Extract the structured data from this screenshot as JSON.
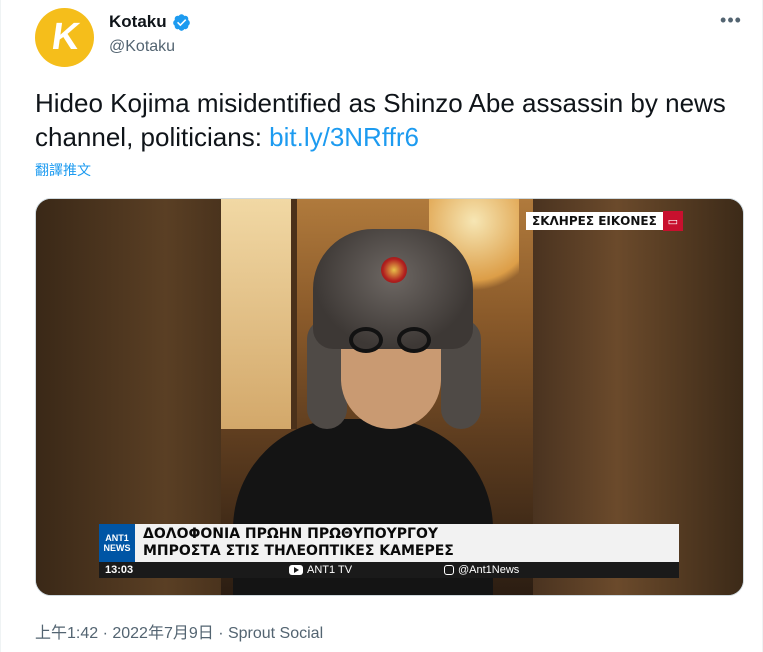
{
  "author": {
    "display_name": "Kotaku",
    "handle": "@Kotaku",
    "avatar_letter": "K",
    "avatar_color": "#f5be1b",
    "verified": true
  },
  "more_label": "•••",
  "tweet": {
    "text": "Hideo Kojima misidentified as Shinzo Abe assassin by news channel, politicians: ",
    "link": "bit.ly/3NRffr6",
    "translate_label": "翻譯推文"
  },
  "media": {
    "tag": "ΣΚΛΗΡΕΣ ΕΙΚΟΝΕΣ",
    "logo_top": "ANT1",
    "logo_bottom": "NEWS",
    "headline_line1": "ΔΟΛΟΦΟΝΙΑ ΠΡΩΗΝ ΠΡΩΘΥΠΟΥΡΓΟΥ",
    "headline_line2": "ΜΠΡΟΣΤΑ ΣΤΙΣ ΤΗΛΕΟΠΤΙΚΕΣ ΚΑΜΕΡΕΣ",
    "ticker_time": "13:03",
    "ticker_yt": "ANT1 TV",
    "ticker_ig": "@Ant1News"
  },
  "meta": {
    "timestamp": "上午1:42 · 2022年7月9日 · Sprout Social"
  },
  "colors": {
    "link": "#1d9bf0",
    "secondary_text": "#536471",
    "verified": "#1d9bf0"
  }
}
